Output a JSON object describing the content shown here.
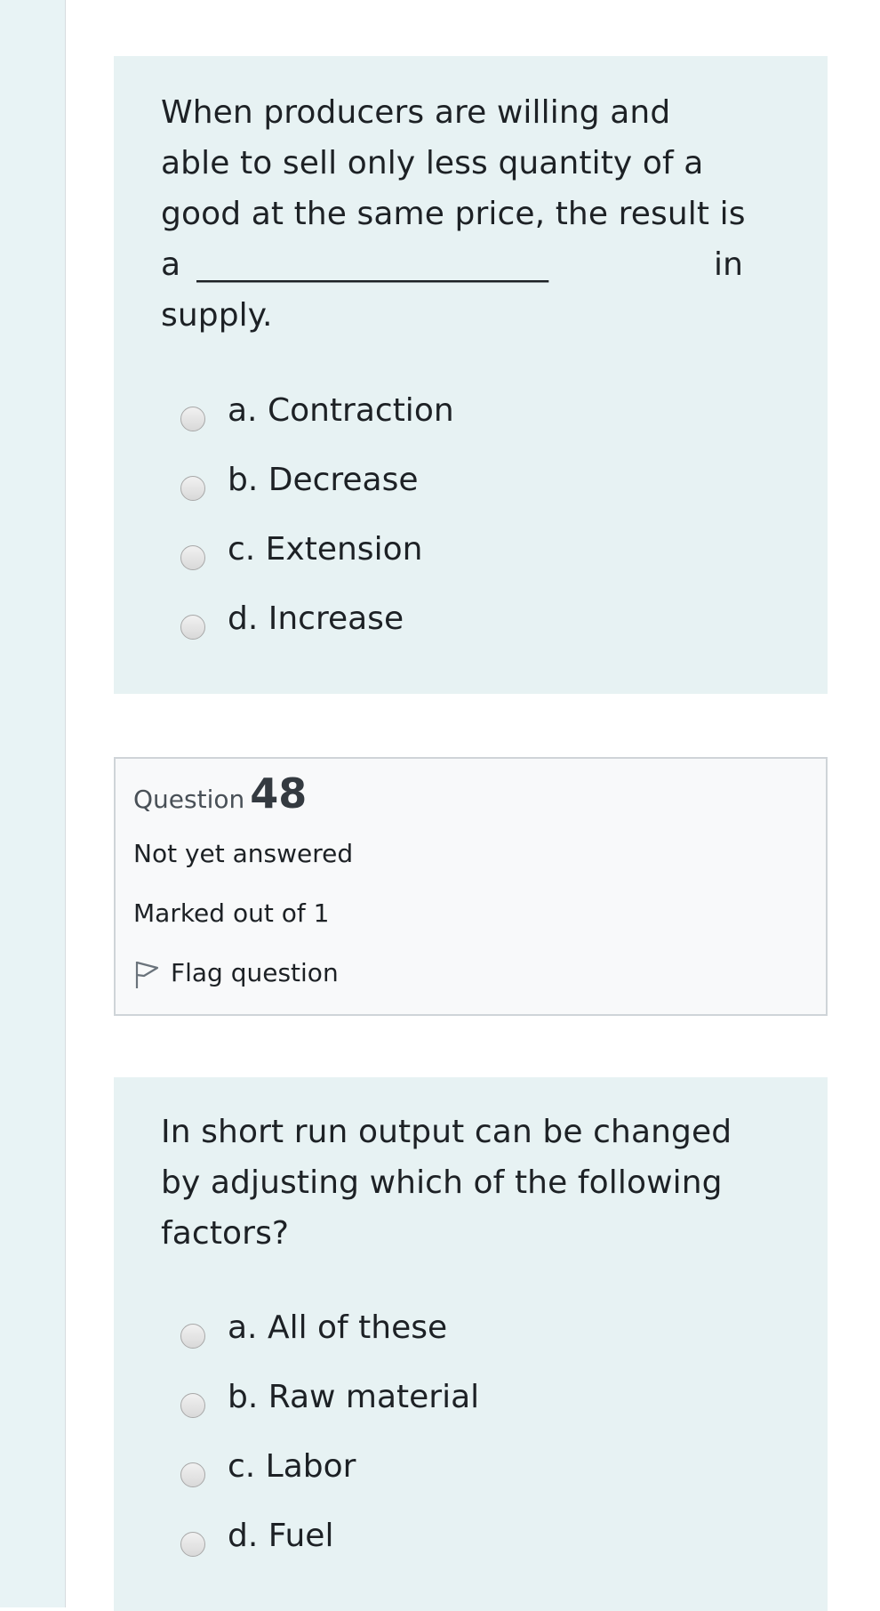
{
  "question47": {
    "text_lines": [
      "When producers are willing and",
      "able to sell only less quantity of a",
      "good at the same price, the result is"
    ],
    "blank_prefix": "a",
    "blank": "______________________",
    "blank_suffix": "in",
    "text_end": "supply.",
    "answers": [
      {
        "label": "a. Contraction"
      },
      {
        "label": "b. Decrease"
      },
      {
        "label": "c. Extension"
      },
      {
        "label": "d. Increase"
      }
    ]
  },
  "question48": {
    "question_word": "Question",
    "number": "48",
    "state": "Not yet answered",
    "grade": "Marked out of 1",
    "flag_label": "Flag question",
    "text_lines": [
      "In short run output can be changed",
      "by adjusting which of the following",
      "factors?"
    ],
    "answers": [
      {
        "label": "a. All of these"
      },
      {
        "label": "b. Raw material"
      },
      {
        "label": "c. Labor"
      },
      {
        "label": "d. Fuel"
      }
    ]
  }
}
